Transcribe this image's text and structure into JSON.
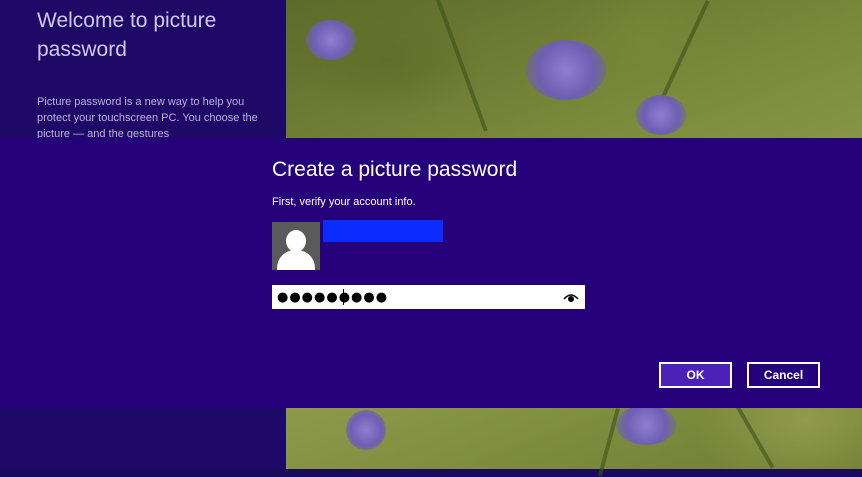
{
  "welcome_panel": {
    "title": "Welcome to picture password",
    "description": "Picture password is a new way to help you protect your touchscreen PC. You choose the picture — and the gestures"
  },
  "dialog": {
    "title": "Create a picture password",
    "subtitle": "First, verify your account info.",
    "account_name": "",
    "password_value": "●●●●●●●●●",
    "reveal_icon": "eye-icon",
    "ok_label": "OK",
    "cancel_label": "Cancel"
  },
  "colors": {
    "accent": "#25007a",
    "panel": "#1e0a66",
    "redaction": "#0a2cff"
  }
}
